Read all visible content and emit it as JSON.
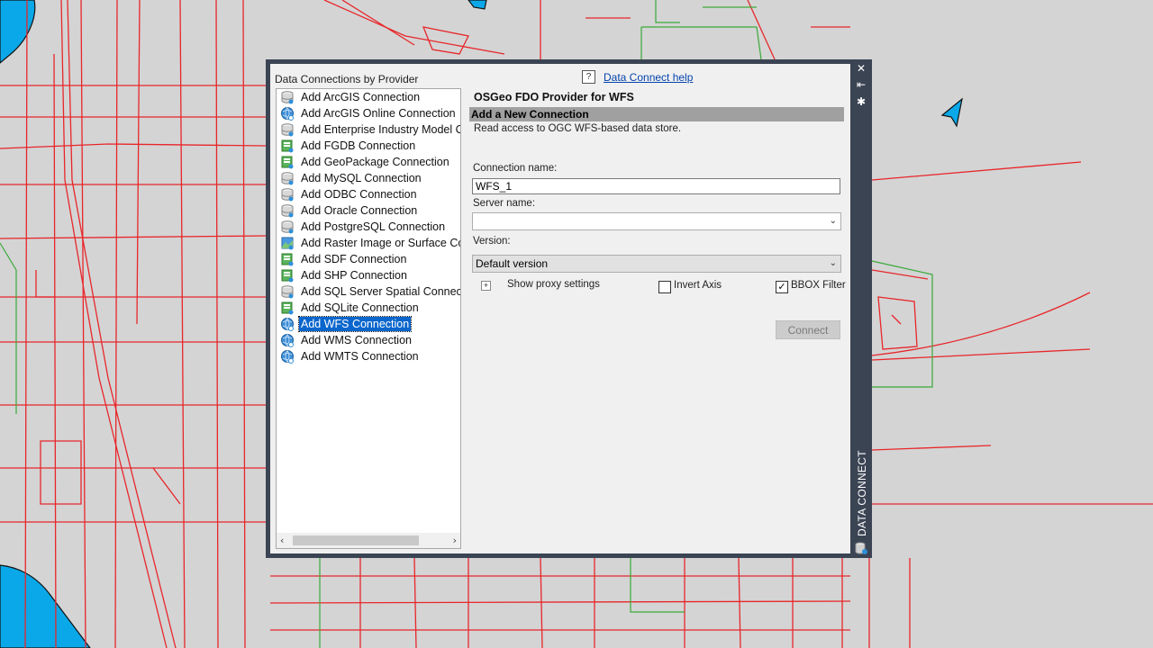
{
  "window": {
    "vertical_title": "DATA CONNECT",
    "close_glyph": "✕",
    "autohide_glyph": "⇤",
    "properties_glyph": "✱"
  },
  "providers": {
    "header": "Data Connections by Provider",
    "items": [
      {
        "label": "Add ArcGIS Connection",
        "icon": "database-icon"
      },
      {
        "label": "Add ArcGIS Online Connection",
        "icon": "globe-icon"
      },
      {
        "label": "Add Enterprise Industry Model Co",
        "icon": "database-icon"
      },
      {
        "label": "Add FGDB Connection",
        "icon": "file-db-icon"
      },
      {
        "label": "Add GeoPackage Connection",
        "icon": "file-db-icon"
      },
      {
        "label": "Add MySQL Connection",
        "icon": "database-icon"
      },
      {
        "label": "Add ODBC Connection",
        "icon": "database-icon"
      },
      {
        "label": "Add Oracle Connection",
        "icon": "database-icon"
      },
      {
        "label": "Add PostgreSQL Connection",
        "icon": "database-icon"
      },
      {
        "label": "Add Raster Image or Surface Conn",
        "icon": "raster-icon"
      },
      {
        "label": "Add SDF Connection",
        "icon": "file-db-icon"
      },
      {
        "label": "Add SHP Connection",
        "icon": "file-db-icon"
      },
      {
        "label": "Add SQL Server Spatial Connectio",
        "icon": "database-icon"
      },
      {
        "label": "Add SQLite Connection",
        "icon": "file-db-icon"
      },
      {
        "label": "Add WFS Connection",
        "icon": "globe-icon",
        "selected": true
      },
      {
        "label": "Add WMS Connection",
        "icon": "globe-icon"
      },
      {
        "label": "Add WMTS Connection",
        "icon": "globe-icon"
      }
    ]
  },
  "help": {
    "icon": "?",
    "link": "Data Connect help"
  },
  "form": {
    "provider_title": "OSGeo FDO Provider for WFS",
    "section_header": "Add a New Connection",
    "description": "Read access to OGC WFS-based data store.",
    "connection_name_label": "Connection name:",
    "connection_name_value": "WFS_1",
    "server_name_label": "Server name:",
    "server_name_value": "",
    "version_label": "Version:",
    "version_value": "Default version",
    "proxy_expander": "+",
    "proxy_label": "Show proxy settings",
    "invert_axis_label": "Invert Axis",
    "invert_axis_checked": false,
    "bbox_filter_label": "BBOX Filter",
    "bbox_filter_checked": true,
    "connect_button": "Connect"
  }
}
